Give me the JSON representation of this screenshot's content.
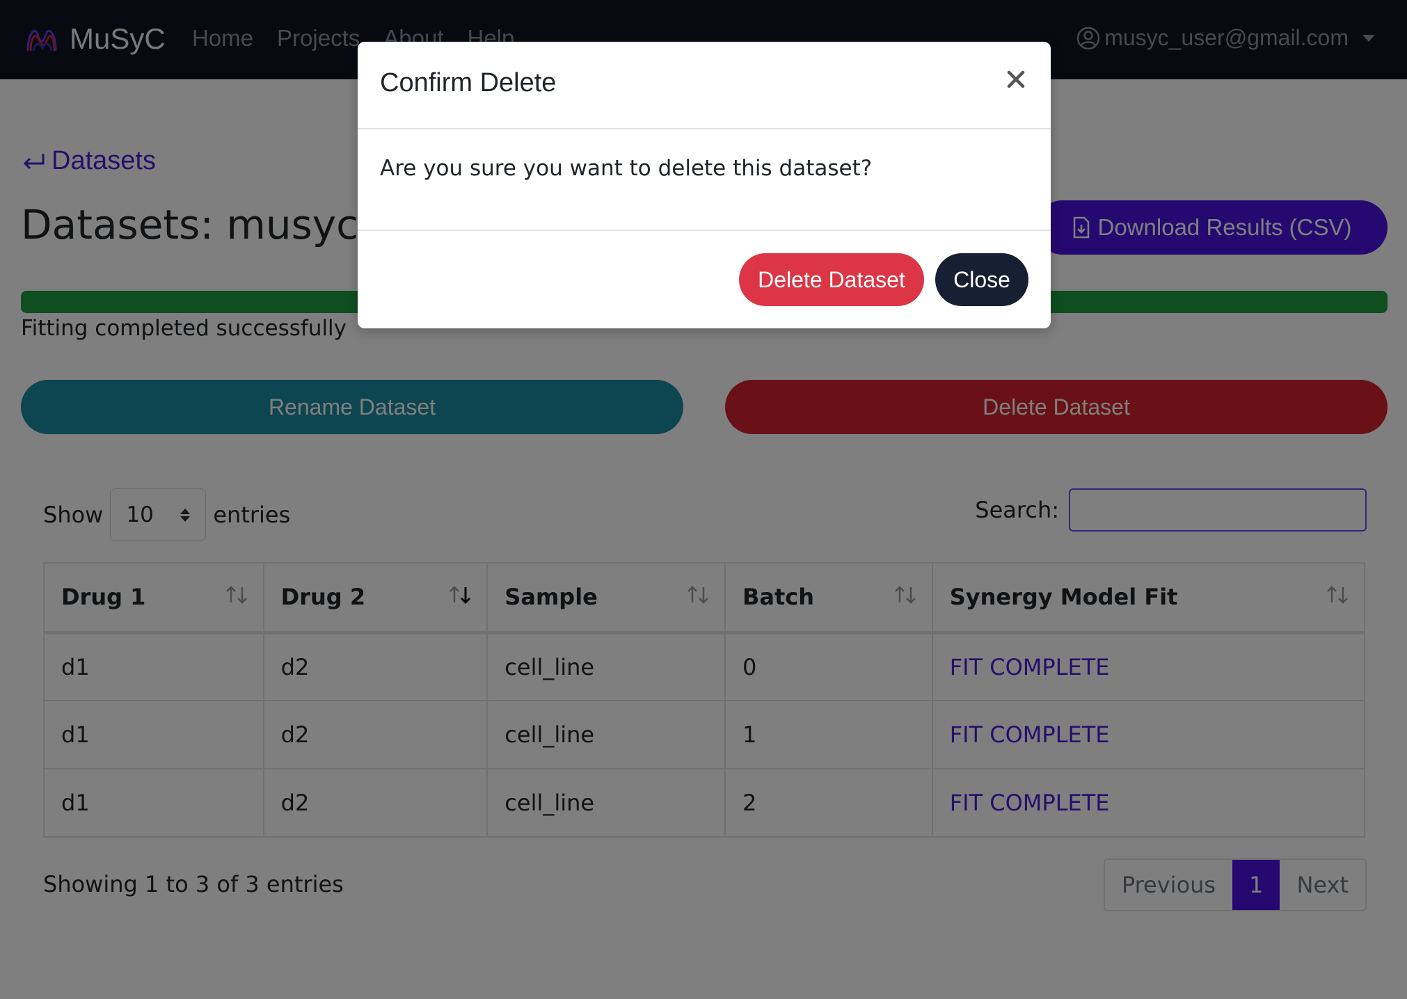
{
  "navbar": {
    "brand": "MuSyC",
    "links": [
      "Home",
      "Projects",
      "About",
      "Help"
    ],
    "user_email": "musyc_user@gmail.com"
  },
  "page": {
    "back_label": "Datasets",
    "title": "Datasets: musyc_de",
    "download_label": "Download Results (CSV)",
    "progress_percent": 100,
    "status_text": "Fitting completed successfully",
    "rename_label": "Rename Dataset",
    "delete_label": "Delete Dataset"
  },
  "table": {
    "show_label": "Show",
    "entries_label": "entries",
    "page_length": "10",
    "search_label": "Search:",
    "search_value": "",
    "columns": [
      "Drug 1",
      "Drug 2",
      "Sample",
      "Batch",
      "Synergy Model Fit"
    ],
    "rows": [
      [
        "d1",
        "d2",
        "cell_line",
        "0",
        "FIT COMPLETE"
      ],
      [
        "d1",
        "d2",
        "cell_line",
        "1",
        "FIT COMPLETE"
      ],
      [
        "d1",
        "d2",
        "cell_line",
        "2",
        "FIT COMPLETE"
      ]
    ],
    "info": "Showing 1 to 3 of 3 entries",
    "pagination": {
      "previous": "Previous",
      "current": "1",
      "next": "Next"
    }
  },
  "modal": {
    "title": "Confirm Delete",
    "body": "Are you sure you want to delete this dataset?",
    "confirm_label": "Delete Dataset",
    "close_label": "Close"
  },
  "colors": {
    "navbar_bg": "#0e1422",
    "primary": "#4a12e0",
    "success": "#1f9d3c",
    "info": "#1b8aa0",
    "danger": "#dc3545",
    "dark": "#172032"
  },
  "icons": {
    "brand": "musyc-logo-icon",
    "user": "user-circle-icon",
    "back": "return-arrow-icon",
    "download": "file-download-icon",
    "sort": "sort-arrows-icon",
    "close": "close-icon"
  }
}
